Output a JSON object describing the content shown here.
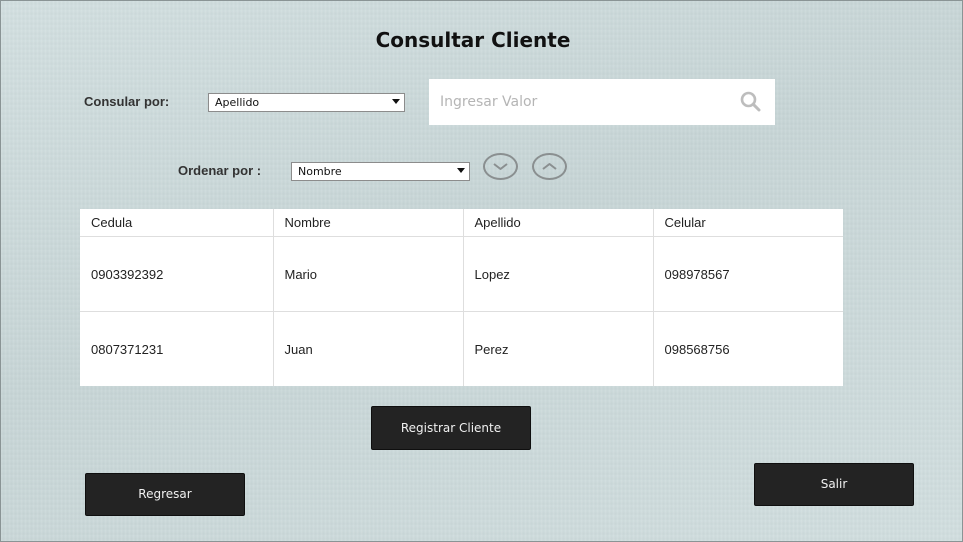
{
  "title": "Consultar Cliente",
  "filter": {
    "consultar_label": "Consular por:",
    "consultar_value": "Apellido",
    "search_placeholder": "Ingresar Valor",
    "search_value": "",
    "ordenar_label": "Ordenar por :",
    "ordenar_value": "Nombre"
  },
  "icons": {
    "search": "search-icon",
    "sort_desc": "chevron-down-icon",
    "sort_asc": "chevron-up-icon"
  },
  "table": {
    "headers": [
      "Cedula",
      "Nombre",
      "Apellido",
      "Celular"
    ],
    "rows": [
      [
        "0903392392",
        "Mario",
        "Lopez",
        "098978567"
      ],
      [
        "0807371231",
        "Juan",
        "Perez",
        "098568756"
      ]
    ]
  },
  "buttons": {
    "registrar": "Registrar Cliente",
    "regresar": "Regresar",
    "salir": "Salir"
  },
  "colors": {
    "background": "#cfdcdd",
    "button": "#232323",
    "button_text": "#f0f0f0"
  }
}
